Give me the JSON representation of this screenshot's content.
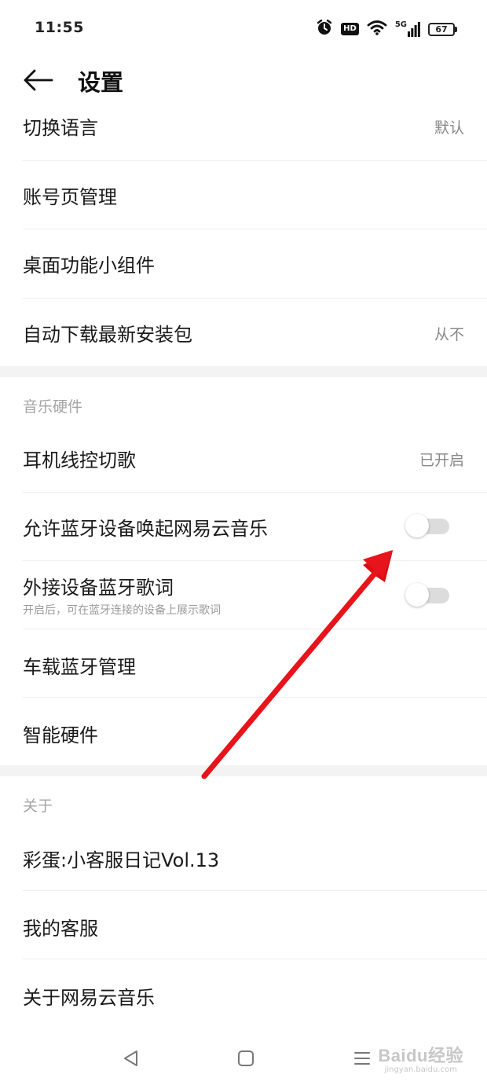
{
  "status_bar": {
    "time": "11:55",
    "hd_badge": "HD",
    "network": "5G",
    "battery": "67",
    "icons": [
      "alarm-icon",
      "hd-icon",
      "wifi-icon",
      "cellular-signal-icon",
      "battery-icon"
    ]
  },
  "header": {
    "title": "设置",
    "back_icon": "back-arrow-icon"
  },
  "general": {
    "items": [
      {
        "label": "切换语言",
        "value": "默认"
      },
      {
        "label": "账号页管理"
      },
      {
        "label": "桌面功能小组件"
      },
      {
        "label": "自动下载最新安装包",
        "value": "从不"
      }
    ]
  },
  "music_hardware": {
    "title": "音乐硬件",
    "items": [
      {
        "label": "耳机线控切歌",
        "value": "已开启"
      },
      {
        "label": "允许蓝牙设备唤起网易云音乐",
        "toggle": "off"
      },
      {
        "label": "外接设备蓝牙歌词",
        "subtitle": "开启后，可在蓝牙连接的设备上展示歌词",
        "toggle": "off"
      },
      {
        "label": "车载蓝牙管理"
      },
      {
        "label": "智能硬件"
      }
    ]
  },
  "about": {
    "title": "关于",
    "items": [
      {
        "label": "彩蛋:小客服日记Vol.13"
      },
      {
        "label": "我的客服"
      },
      {
        "label": "关于网易云音乐"
      }
    ]
  },
  "nav_bar": {
    "icons": [
      "back-triangle-icon",
      "home-square-icon",
      "recents-menu-icon"
    ]
  },
  "watermark": {
    "main": "Baidu经验",
    "sub": "jingyan.baidu.com"
  },
  "colors": {
    "annotation_arrow": "#e8141b",
    "toggle_off": "#dcdcdc",
    "section_band": "#f3f3f3"
  }
}
